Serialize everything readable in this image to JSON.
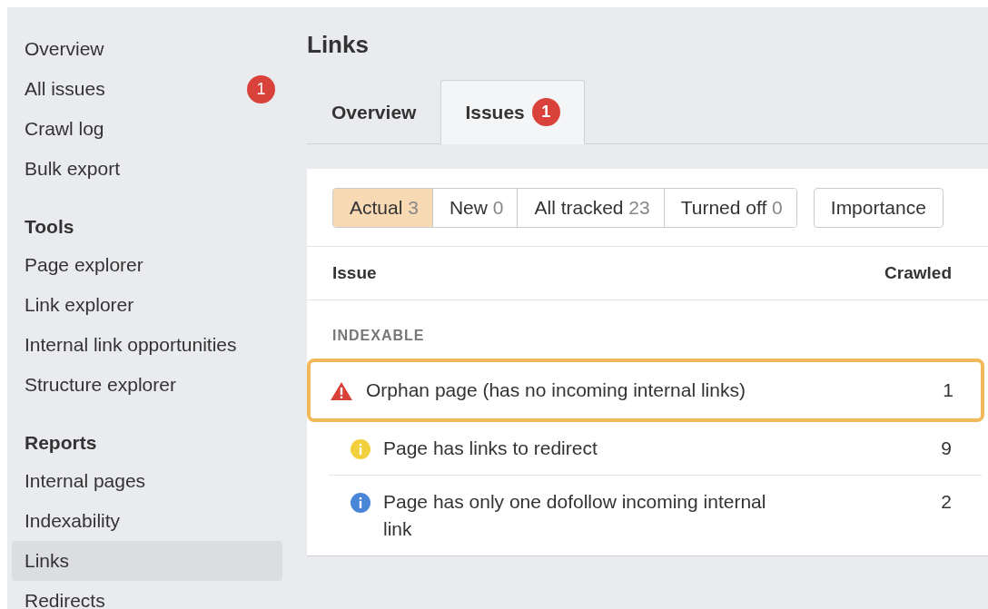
{
  "sidebar": {
    "sections": [
      {
        "items": [
          {
            "label": "Overview",
            "selected": false
          },
          {
            "label": "All issues",
            "selected": false,
            "badge": "1"
          },
          {
            "label": "Crawl log",
            "selected": false
          },
          {
            "label": "Bulk export",
            "selected": false
          }
        ]
      },
      {
        "heading": "Tools",
        "items": [
          {
            "label": "Page explorer",
            "selected": false
          },
          {
            "label": "Link explorer",
            "selected": false
          },
          {
            "label": "Internal link opportunities",
            "selected": false
          },
          {
            "label": "Structure explorer",
            "selected": false
          }
        ]
      },
      {
        "heading": "Reports",
        "items": [
          {
            "label": "Internal pages",
            "selected": false
          },
          {
            "label": "Indexability",
            "selected": false
          },
          {
            "label": "Links",
            "selected": true
          },
          {
            "label": "Redirects",
            "selected": false
          }
        ]
      }
    ]
  },
  "page_title": "Links",
  "tabs": [
    {
      "label": "Overview",
      "selected": false
    },
    {
      "label": "Issues",
      "selected": true,
      "badge": "1"
    }
  ],
  "filters": [
    {
      "label": "Actual",
      "count": "3",
      "selected": true
    },
    {
      "label": "New",
      "count": "0",
      "selected": false
    },
    {
      "label": "All tracked",
      "count": "23",
      "selected": false
    },
    {
      "label": "Turned off",
      "count": "0",
      "selected": false
    }
  ],
  "importance_button": "Importance",
  "table": {
    "columns": [
      "Issue",
      "Crawled"
    ],
    "group": "INDEXABLE",
    "rows": [
      {
        "kind": "error",
        "issue": "Orphan page (has no incoming internal links)",
        "crawled": "1",
        "highlighted": true
      },
      {
        "kind": "warning",
        "issue": "Page has links to redirect",
        "crawled": "9",
        "highlighted": false
      },
      {
        "kind": "notice",
        "issue": "Page has only one dofollow incoming internal link",
        "crawled": "2",
        "highlighted": false
      }
    ]
  }
}
